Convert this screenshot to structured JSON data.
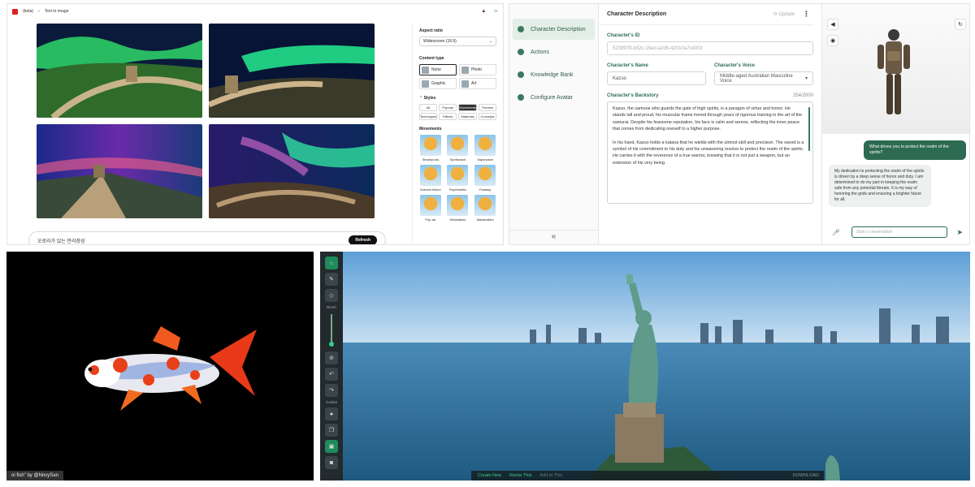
{
  "text_to_image": {
    "beta_label": "(beta)",
    "breadcrumb": "Text to image",
    "prompt_value": "오로라가 있는 만리장성",
    "refresh_label": "Refresh",
    "aspect_ratio": {
      "label": "Aspect ratio",
      "value": "Widescreen (16:9)"
    },
    "content_type": {
      "label": "Content type",
      "options": [
        "None",
        "Photo",
        "Graphic",
        "Art"
      ],
      "selected": "None"
    },
    "styles": {
      "label": "Styles",
      "chips": [
        "All",
        "Popular",
        "Movements",
        "Themes",
        "Techniques",
        "Effects",
        "Materials",
        "Concepts"
      ],
      "active_chip": "Movements",
      "section_label": "Movements",
      "items": [
        "Steampunk",
        "Synthwave",
        "Vaporwave",
        "Science fiction",
        "Psychedelic",
        "Fantasy",
        "Pop art",
        "Minimalism",
        "Maximalism"
      ]
    }
  },
  "character": {
    "nav": [
      "Character Description",
      "Actions",
      "Knowledge Bank",
      "Configure Avatar"
    ],
    "nav_active": "Character Description",
    "collapse_glyph": "«",
    "header_title": "Character Description",
    "update_label": "Update",
    "id_label": "Character's ID",
    "id_value": "5239979-b52c-15ed-a2d5-42010a7c4003",
    "name_label": "Character's Name",
    "name_value": "Kazuo",
    "voice_label": "Character's Voice",
    "voice_value": "Middle-aged Australian Masculine Voice",
    "backstory_label": "Character's Backstory",
    "backstory_count": "254/2000",
    "backstory_p1": "Kazuo, the samurai who guards the gate of high spirits, is a paragon of virtue and honor. He stands tall and proud, his muscular frame honed through years of rigorous training in the art of the samurai. Despite his fearsome reputation, his face is calm and serene, reflecting the inner peace that comes from dedicating oneself to a higher purpose.",
    "backstory_p2": "In his hand, Kazuo holds a katana that he wields with the utmost skill and precision. The sword is a symbol of his commitment to his duty and his unwavering resolve to protect the realm of the spirits. He carries it with the reverence of a true warrior, knowing that it is not just a weapon, but an extension of his very being.",
    "user_message": "What drives you to protect the realm of the spirits?",
    "bot_message": "My dedication to protecting the realm of the spirits is driven by a deep sense of honor and duty. I am determined to do my part in keeping the realm safe from any potential threats. It is my way of honoring the gods and ensuring a brighter future for all.",
    "chat_placeholder": "Start a conversation"
  },
  "koi": {
    "credit": "oi fish\" by @NovySan"
  },
  "scene_editor": {
    "tool_labels": {
      "brush": "Brush",
      "guides": "Guides"
    },
    "bottom_actions": [
      "Create New",
      "Remix This",
      "Add to This"
    ],
    "bottom_right": "DOWNLOAD"
  },
  "colors": {
    "accent_green": "#2d6a52",
    "scene_green": "#3fd08e"
  }
}
